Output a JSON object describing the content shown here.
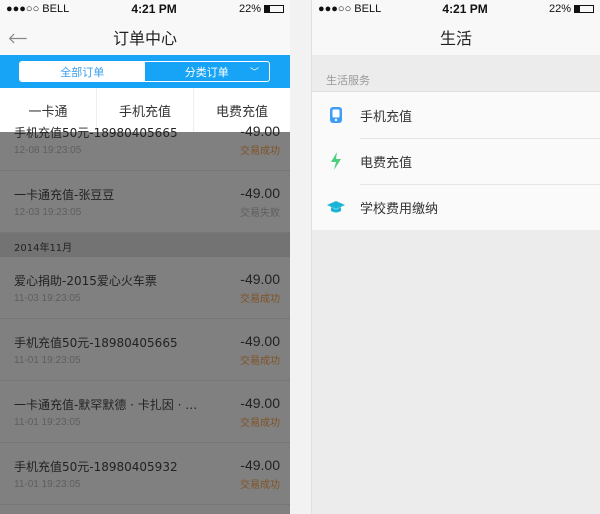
{
  "status_bar": {
    "carrier": "●●●○○ BELL",
    "time": "4:21 PM",
    "battery": "22%"
  },
  "left": {
    "title": "订单中心",
    "segments": {
      "all": "全部订单",
      "category": "分类订单"
    },
    "filters": [
      "一卡通",
      "手机充值",
      "电费充值"
    ],
    "rows_top": [
      {
        "title": "手机充值50元-18980405665",
        "date": "12-08   19:23:05",
        "amount": "-49.00",
        "status": "交易成功",
        "fail": false
      },
      {
        "title": "一卡通充值-张豆豆",
        "date": "12-03   19:23:05",
        "amount": "-49.00",
        "status": "交易失败",
        "fail": true
      }
    ],
    "section": "2014年11月",
    "rows": [
      {
        "title": "爱心捐助-2015爱心火车票",
        "date": "11-03   19:23:05",
        "amount": "-49.00",
        "status": "交易成功"
      },
      {
        "title": "手机充值50元-18980405665",
        "date": "11-01   19:23:05",
        "amount": "-49.00",
        "status": "交易成功"
      },
      {
        "title": "一卡通充值-默罕默德 · 卡扎因 · …",
        "date": "11-01   19:23:05",
        "amount": "-49.00",
        "status": "交易成功"
      },
      {
        "title": "手机充值50元-18980405932",
        "date": "11-01   19:23:05",
        "amount": "-49.00",
        "status": "交易成功"
      }
    ]
  },
  "right": {
    "title": "生活",
    "section": "生活服务",
    "items": [
      {
        "label": "手机充值",
        "icon": "phone-icon",
        "color": "#3d9ef5"
      },
      {
        "label": "电费充值",
        "icon": "lightning-icon",
        "color": "#4cd07d"
      },
      {
        "label": "学校费用缴纳",
        "icon": "graduation-cap-icon",
        "color": "#19b4d8"
      }
    ]
  },
  "colors": {
    "accent": "#18a4f6",
    "success": "#7f5326"
  }
}
